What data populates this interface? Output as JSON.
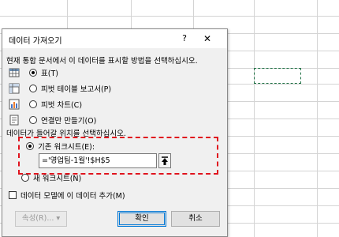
{
  "dialog": {
    "title": "데이터 가져오기",
    "help_glyph": "?",
    "close_glyph": "✕",
    "view_prompt": "현재 통합 문서에서 이 데이터를 표시할 방법을 선택하십시오.",
    "view_options": [
      {
        "label": "표(T)",
        "selected": true,
        "icon": "table-icon"
      },
      {
        "label": "피벗 테이블 보고서(P)",
        "selected": false,
        "icon": "pivottable-icon"
      },
      {
        "label": "피벗 차트(C)",
        "selected": false,
        "icon": "pivotchart-icon"
      },
      {
        "label": "연결만 만들기(O)",
        "selected": false,
        "icon": "connection-icon"
      }
    ],
    "location_prompt": "데이터가 들어갈 위치를 선택하십시오.",
    "existing_sheet_label": "기존 워크시트(E):",
    "existing_sheet_selected": true,
    "reference_value": "='영업팀-1월'!$H$5",
    "new_sheet_label": "새 워크시트(N)",
    "new_sheet_selected": false,
    "data_model_label": "데이터 모델에 이 데이터 추가(M)",
    "data_model_checked": false,
    "properties_button": "속성(R)... ▾",
    "ok_button": "확인",
    "cancel_button": "취소"
  },
  "colors": {
    "highlight": "#e0141e",
    "selection_marquee": "#217346",
    "accent": "#0078d7"
  }
}
